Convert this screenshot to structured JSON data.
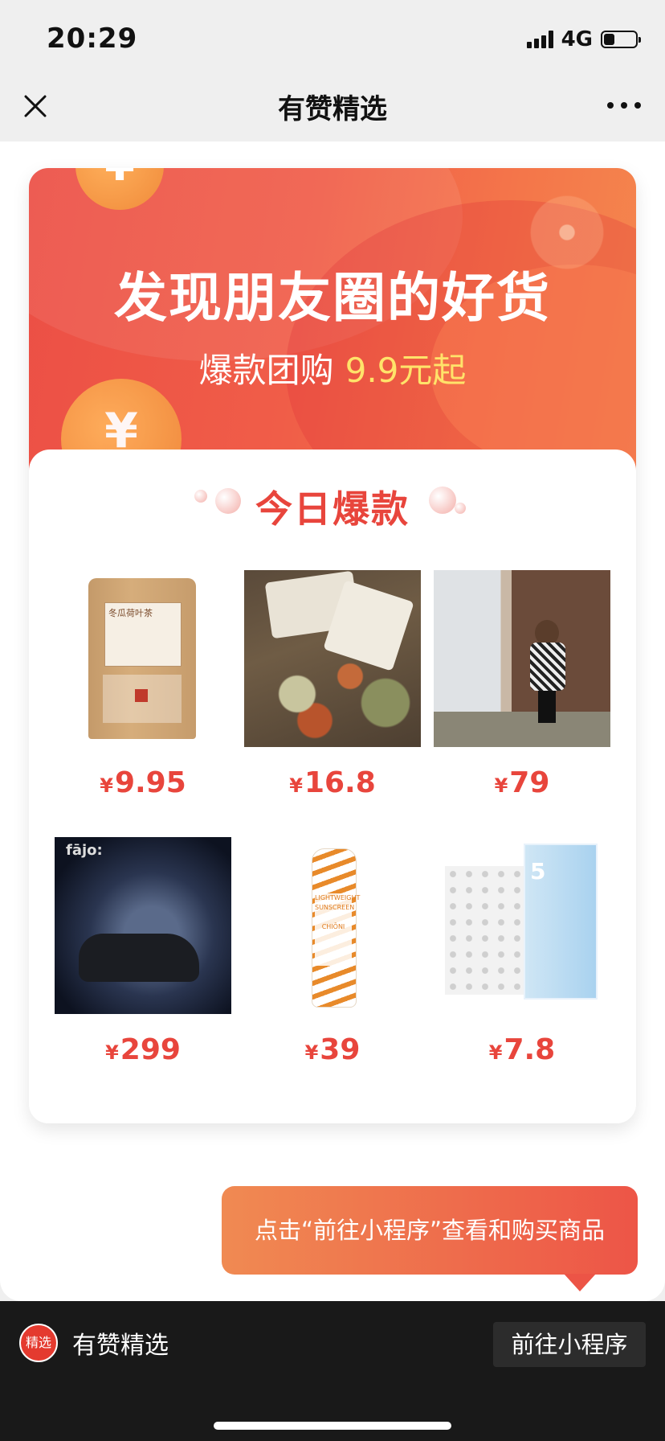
{
  "status_bar": {
    "time": "20:29",
    "network": "4G",
    "battery_level": 0.35
  },
  "nav": {
    "title": "有赞精选"
  },
  "banner": {
    "title": "发现朋友圈的好货",
    "subtitle_main": "爆款团购",
    "subtitle_highlight": "9.9元起",
    "coin_symbol": "¥"
  },
  "section": {
    "title": "今日爆款"
  },
  "currency": "¥",
  "products": [
    {
      "image": "herbal-tea-bag",
      "label": "冬瓜荷叶茶",
      "price": "9.95"
    },
    {
      "image": "herbs-and-spices",
      "price": "16.8"
    },
    {
      "image": "girl-plaid-coat",
      "price": "79"
    },
    {
      "image": "black-sneaker",
      "brand": "fājo:",
      "price": "299"
    },
    {
      "image": "sunscreen-spray",
      "brand": "CHIŌNI",
      "label": "LIGHTWEIGHT SUNSCREEN",
      "price": "39"
    },
    {
      "image": "toilet-paper-rolls",
      "label": "5",
      "price": "7.8"
    }
  ],
  "tip_bubble": {
    "text": "点击“前往小程序”查看和购买商品"
  },
  "bottom_bar": {
    "logo_text": "精选",
    "name": "有赞精选",
    "button_label": "前往小程序"
  }
}
